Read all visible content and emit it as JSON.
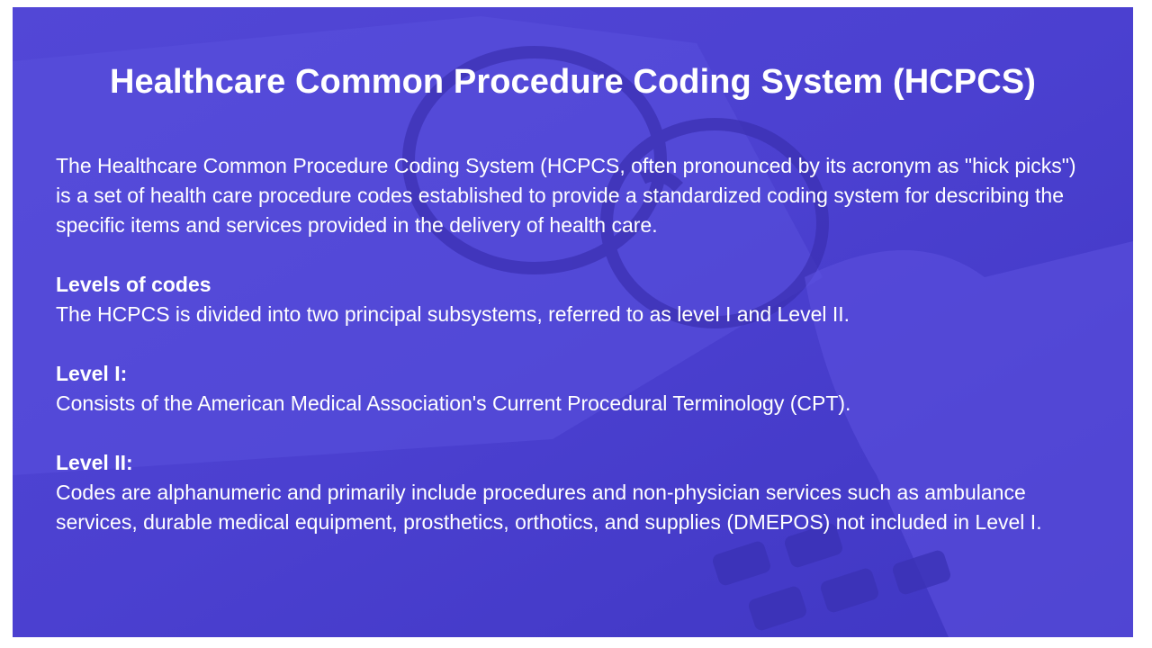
{
  "slide": {
    "title": "Healthcare Common Procedure Coding System (HCPCS)",
    "intro": "The Healthcare Common Procedure Coding System (HCPCS, often pronounced by its acronym as \"hick picks\") is a set of health care procedure codes established to provide a standardized coding system for describing the specific items and services provided in the delivery of health care.",
    "sections": [
      {
        "heading": "Levels of codes",
        "text": "The HCPCS is divided into two principal subsystems, referred to as level I and Level II."
      },
      {
        "heading": "Level I:",
        "text": "Consists of the American Medical Association's Current Procedural Terminology (CPT)."
      },
      {
        "heading": "Level II:",
        "text": "Codes are alphanumeric and primarily include procedures and non-physician services such as ambulance services, durable medical equipment, prosthetics, orthotics, and supplies (DMEPOS) not included in Level I."
      }
    ]
  },
  "colors": {
    "overlay": "#4a3fd0",
    "text": "#ffffff"
  }
}
